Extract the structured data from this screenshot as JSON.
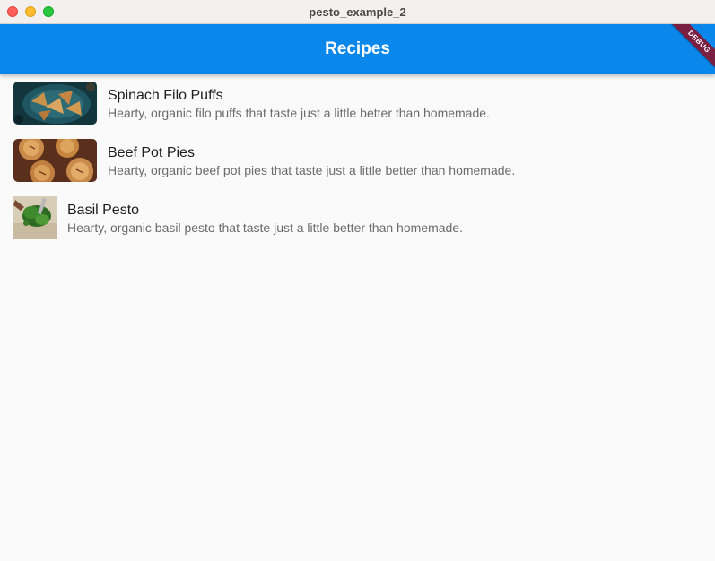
{
  "window": {
    "title": "pesto_example_2"
  },
  "appbar": {
    "title": "Recipes",
    "debug_label": "DEBUG",
    "color": "#0a87ea"
  },
  "recipes": [
    {
      "title": "Spinach Filo Puffs",
      "description": "Hearty, organic filo puffs that taste just a little better than homemade.",
      "image": "spinach-filo-puffs-photo"
    },
    {
      "title": "Beef Pot Pies",
      "description": "Hearty, organic beef pot pies that taste just a little better than homemade.",
      "image": "beef-pot-pies-photo"
    },
    {
      "title": "Basil Pesto",
      "description": "Hearty, organic basil pesto that taste just a little better than homemade.",
      "image": "basil-pesto-photo"
    }
  ]
}
